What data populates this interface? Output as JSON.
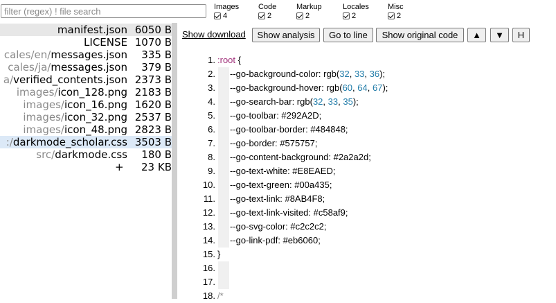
{
  "filter": {
    "placeholder": "filter (regex) ! file search",
    "value": ""
  },
  "categories": [
    {
      "label": "Images",
      "count": "4"
    },
    {
      "label": "Code",
      "count": "2"
    },
    {
      "label": "Markup",
      "count": "2"
    },
    {
      "label": "Locales",
      "count": "2"
    },
    {
      "label": "Misc",
      "count": "2"
    }
  ],
  "files": [
    {
      "dir": "",
      "name": "manifest.json",
      "size": "6050 B"
    },
    {
      "dir": "",
      "name": "LICENSE",
      "size": "1070 B"
    },
    {
      "dir": "cales/en/",
      "name": "messages.json",
      "size": "335 B"
    },
    {
      "dir": "cales/ja/",
      "name": "messages.json",
      "size": "379 B"
    },
    {
      "dir": "a/",
      "name": "verified_contents.json",
      "size": "2373 B"
    },
    {
      "dir": "images/",
      "name": "icon_128.png",
      "size": "2183 B"
    },
    {
      "dir": "images/",
      "name": "icon_16.png",
      "size": "1620 B"
    },
    {
      "dir": "images/",
      "name": "icon_32.png",
      "size": "2537 B"
    },
    {
      "dir": "images/",
      "name": "icon_48.png",
      "size": "2823 B"
    },
    {
      "dir": ":/",
      "name": "darkmode_scholar.css",
      "size": "3503 B"
    },
    {
      "dir": "src/",
      "name": "darkmode.css",
      "size": "180 B"
    }
  ],
  "total": {
    "plus": "+",
    "size": "23 KB"
  },
  "toolbar": {
    "download_label": "Show download",
    "analysis_label": "Show analysis",
    "goto_label": "Go to line",
    "original_label": "Show original code",
    "up_label": "▲",
    "down_label": "▼",
    "h_label": "H"
  },
  "code_lines": [
    {
      "num": "1.",
      "indent": false,
      "parts": [
        {
          "t": ":root",
          "c": "sel"
        },
        {
          "t": " {",
          "c": ""
        }
      ]
    },
    {
      "num": "2.",
      "indent": true,
      "parts": [
        {
          "t": "--go-background-color: rgb(",
          "c": ""
        },
        {
          "t": "32",
          "c": "num"
        },
        {
          "t": ", ",
          "c": ""
        },
        {
          "t": "33",
          "c": "num"
        },
        {
          "t": ", ",
          "c": ""
        },
        {
          "t": "36",
          "c": "num"
        },
        {
          "t": ");",
          "c": ""
        }
      ]
    },
    {
      "num": "3.",
      "indent": true,
      "parts": [
        {
          "t": "--go-background-hover: rgb(",
          "c": ""
        },
        {
          "t": "60",
          "c": "num"
        },
        {
          "t": ", ",
          "c": ""
        },
        {
          "t": "64",
          "c": "num"
        },
        {
          "t": ", ",
          "c": ""
        },
        {
          "t": "67",
          "c": "num"
        },
        {
          "t": ");",
          "c": ""
        }
      ]
    },
    {
      "num": "4.",
      "indent": true,
      "parts": [
        {
          "t": "--go-search-bar: rgb(",
          "c": ""
        },
        {
          "t": "32",
          "c": "num"
        },
        {
          "t": ", ",
          "c": ""
        },
        {
          "t": "33",
          "c": "num"
        },
        {
          "t": ", ",
          "c": ""
        },
        {
          "t": "35",
          "c": "num"
        },
        {
          "t": ");",
          "c": ""
        }
      ]
    },
    {
      "num": "5.",
      "indent": true,
      "parts": [
        {
          "t": "--go-toolbar: #292A2D;",
          "c": ""
        }
      ]
    },
    {
      "num": "6.",
      "indent": true,
      "parts": [
        {
          "t": "--go-toolbar-border: #484848;",
          "c": ""
        }
      ]
    },
    {
      "num": "7.",
      "indent": true,
      "parts": [
        {
          "t": "--go-border: #575757;",
          "c": ""
        }
      ]
    },
    {
      "num": "8.",
      "indent": true,
      "parts": [
        {
          "t": "--go-content-background: #2a2a2d;",
          "c": ""
        }
      ]
    },
    {
      "num": "9.",
      "indent": true,
      "parts": [
        {
          "t": "--go-text-white: #E8EAED;",
          "c": ""
        }
      ]
    },
    {
      "num": "10.",
      "indent": true,
      "parts": [
        {
          "t": "--go-text-green: #00a435;",
          "c": ""
        }
      ]
    },
    {
      "num": "11.",
      "indent": true,
      "parts": [
        {
          "t": "--go-text-link: #8AB4F8;",
          "c": ""
        }
      ]
    },
    {
      "num": "12.",
      "indent": true,
      "parts": [
        {
          "t": "--go-text-link-visited: #c58af9;",
          "c": ""
        }
      ]
    },
    {
      "num": "13.",
      "indent": true,
      "parts": [
        {
          "t": "--go-svg-color: #c2c2c2;",
          "c": ""
        }
      ]
    },
    {
      "num": "14.",
      "indent": true,
      "parts": [
        {
          "t": "--go-link-pdf: #eb6060;",
          "c": ""
        }
      ]
    },
    {
      "num": "15.",
      "indent": false,
      "parts": [
        {
          "t": "}",
          "c": ""
        }
      ]
    },
    {
      "num": "16.",
      "indent": false,
      "parts": []
    },
    {
      "num": "17.",
      "indent": false,
      "parts": []
    },
    {
      "num": "18.",
      "indent": false,
      "parts": [
        {
          "t": "/*",
          "c": "com"
        }
      ]
    }
  ],
  "colors": {
    "selector": "#a0307a",
    "number": "#1f7ba8",
    "selected_row_gray": "#e7e7e7",
    "selected_row_blue": "#dce9f7",
    "divider": "#cfcfcf"
  }
}
